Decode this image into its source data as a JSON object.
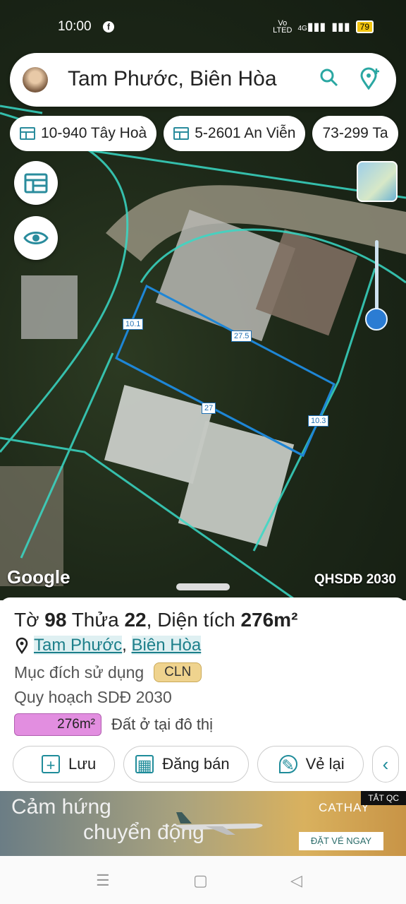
{
  "status_bar": {
    "time": "10:00",
    "network_label_top": "Vo",
    "network_label_bottom": "LTED",
    "network_type": "4G",
    "battery": "79"
  },
  "search": {
    "title": "Tam Phước, Biên Hòa"
  },
  "chips": [
    {
      "label": "10-940 Tây Hoà"
    },
    {
      "label": "5-2601 An Viễn"
    },
    {
      "label": "73-299 Ta"
    }
  ],
  "map": {
    "google_logo": "Google",
    "layer_label": "QHSDĐ 2030",
    "dimensions": [
      "10.1",
      "27.5",
      "27",
      "10.3"
    ]
  },
  "sheet": {
    "parcel": {
      "prefix": "Tờ",
      "sheet_no": "98",
      "plot_word": "Thửa",
      "plot_no": "22",
      "area_word": "Diện tích",
      "area": "276m²"
    },
    "location": {
      "ward": "Tam Phước",
      "separator": ",",
      "city": "Biên Hòa"
    },
    "purpose_label": "Mục đích sử dụng",
    "purpose_code": "CLN",
    "plan_label": "Quy hoạch SDĐ 2030",
    "plan_area": "276m²",
    "plan_description": "Đất ở tại đô thị"
  },
  "actions": [
    {
      "label": "Lưu"
    },
    {
      "label": "Đăng bán"
    },
    {
      "label": "Vẻ lại"
    }
  ],
  "ad": {
    "line1": "Cảm hứng",
    "line2": "chuyển động",
    "brand": "CATHAY",
    "cta": "ĐẶT VÉ NGAY",
    "close": "TẮT QC"
  }
}
